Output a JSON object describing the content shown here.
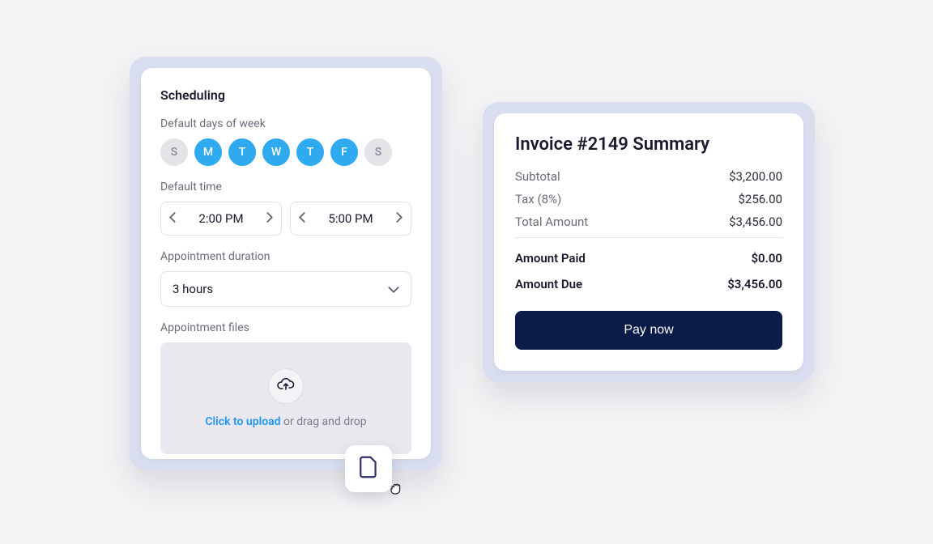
{
  "scheduling": {
    "title": "Scheduling",
    "days_label": "Default days of week",
    "days": [
      {
        "label": "S",
        "active": false
      },
      {
        "label": "M",
        "active": true
      },
      {
        "label": "T",
        "active": true
      },
      {
        "label": "W",
        "active": true
      },
      {
        "label": "T",
        "active": true
      },
      {
        "label": "F",
        "active": true
      },
      {
        "label": "S",
        "active": false
      }
    ],
    "time_label": "Default time",
    "start_time": "2:00 PM",
    "end_time": "5:00 PM",
    "duration_label": "Appointment duration",
    "duration_value": "3 hours",
    "files_label": "Appointment files",
    "upload_link": "Click to upload",
    "upload_suffix": "or drag and drop"
  },
  "invoice": {
    "title": "Invoice #2149 Summary",
    "subtotal_label": "Subtotal",
    "subtotal_value": "$3,200.00",
    "tax_label": "Tax (8%)",
    "tax_value": "$256.00",
    "total_label": "Total Amount",
    "total_value": "$3,456.00",
    "paid_label": "Amount Paid",
    "paid_value": "$0.00",
    "due_label": "Amount Due",
    "due_value": "$3,456.00",
    "pay_button": "Pay now"
  }
}
